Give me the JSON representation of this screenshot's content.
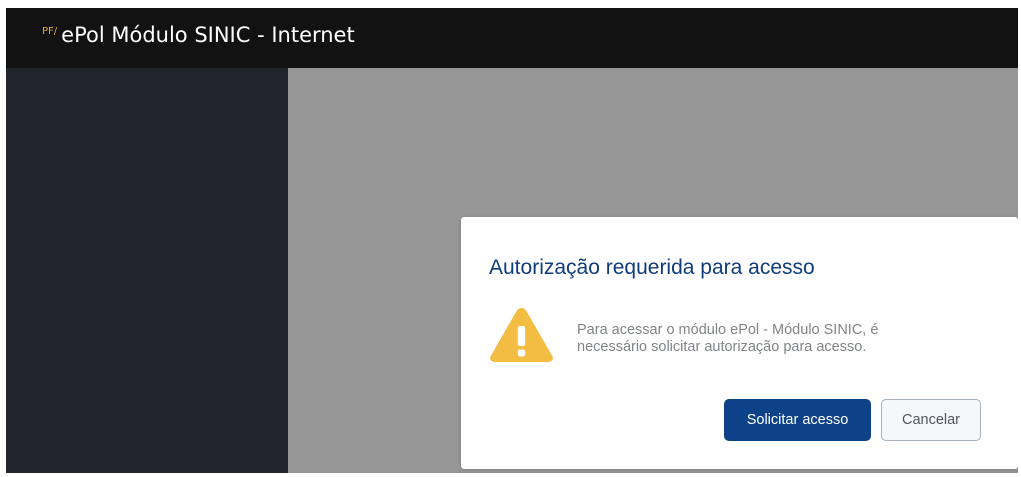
{
  "header": {
    "prefix": "PF/",
    "title": "ePol Módulo SINIC - Internet"
  },
  "modal": {
    "title": "Autorização requerida para acesso",
    "icon": "warning-icon",
    "message": "Para acessar o módulo ePol - Módulo SINIC, é necessário solicitar autorização para acesso.",
    "primary_button_label": "Solicitar acesso",
    "secondary_button_label": "Cancelar"
  },
  "colors": {
    "topbar": "#121212",
    "sidebar": "#22252b",
    "overlay": "#979797",
    "modal_title": "#0e3d7a",
    "primary_button": "#0d4288",
    "warning": "#f2bd42"
  }
}
